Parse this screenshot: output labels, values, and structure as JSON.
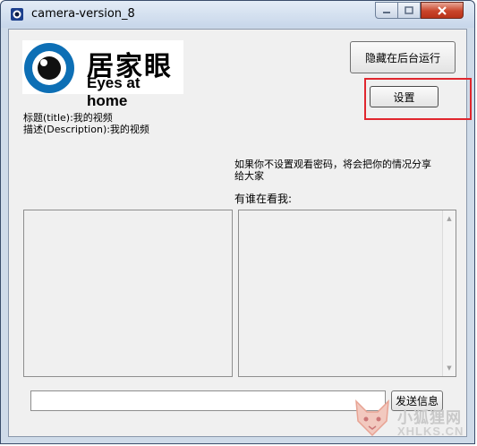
{
  "window": {
    "title": "camera-version_8",
    "controls": {
      "minimize_icon": "minimize-icon",
      "maximize_icon": "maximize-icon",
      "close_icon": "close-icon"
    }
  },
  "logo": {
    "cn": "居家眼",
    "en": "Eyes at home"
  },
  "buttons": {
    "hide_run": "隐藏在后台运行",
    "settings": "设置",
    "send": "发送信息"
  },
  "meta": {
    "title_line": "标题(title):我的视频",
    "description_line": "描述(Description):我的视频"
  },
  "notice": "如果你不设置观看密码，将会把你的情况分享给大家",
  "watchers_label": "有谁在看我:",
  "message_input": {
    "value": ""
  },
  "watermark": {
    "cn": "小狐狸网",
    "en": "XHLKS.CN"
  },
  "colors": {
    "highlight": "#e0262e",
    "close_button": "#c9442a"
  }
}
